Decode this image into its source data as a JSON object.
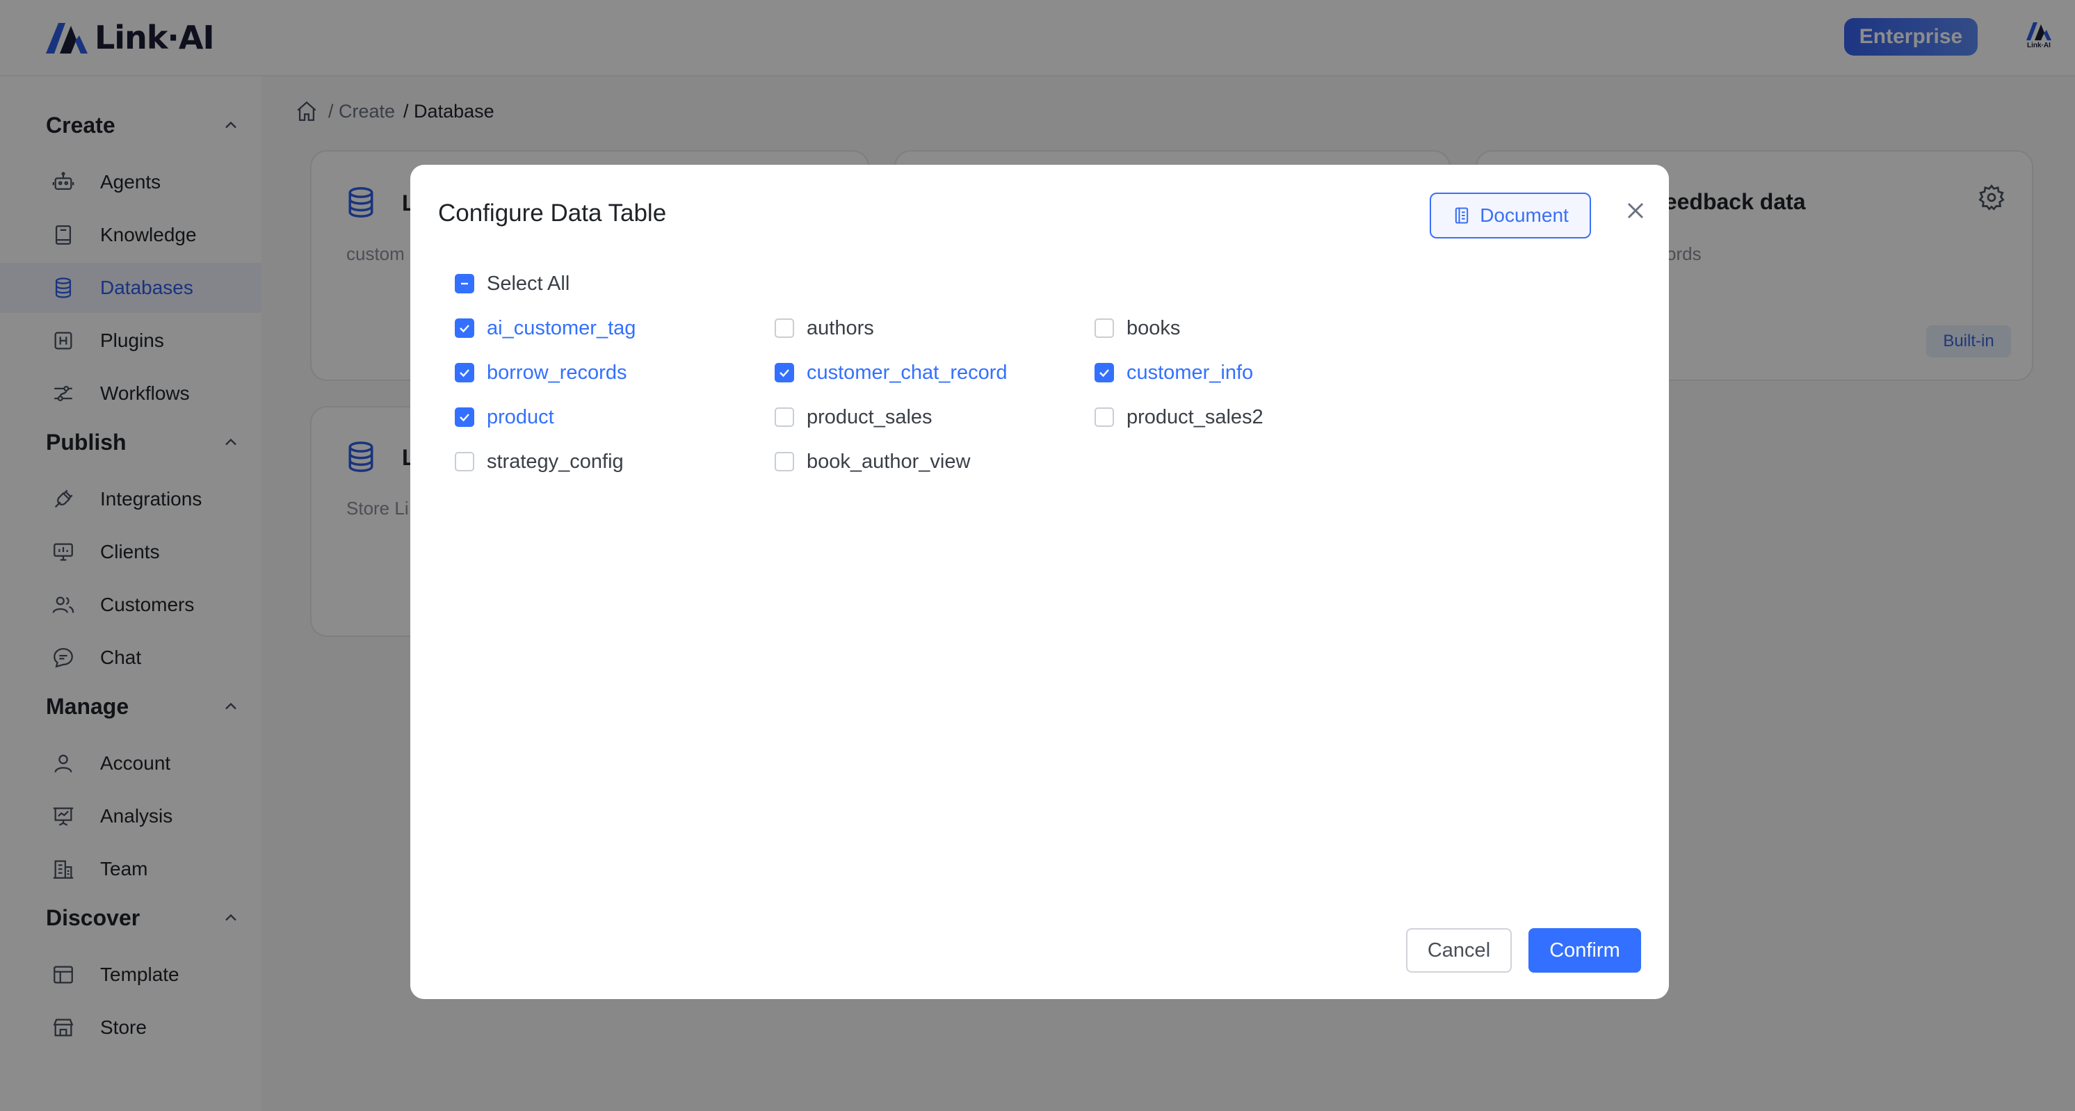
{
  "header": {
    "logo_text": "Link·AI",
    "enterprise_label": "Enterprise",
    "avatar_text": "Link·AI"
  },
  "sidebar": {
    "groups": [
      {
        "title": "Create",
        "items": [
          {
            "label": "Agents",
            "icon": "robot-icon"
          },
          {
            "label": "Knowledge",
            "icon": "book-icon"
          },
          {
            "label": "Databases",
            "icon": "database-icon",
            "active": true
          },
          {
            "label": "Plugins",
            "icon": "plugin-icon"
          },
          {
            "label": "Workflows",
            "icon": "workflow-icon"
          }
        ]
      },
      {
        "title": "Publish",
        "items": [
          {
            "label": "Integrations",
            "icon": "plug-icon"
          },
          {
            "label": "Clients",
            "icon": "monitor-icon"
          },
          {
            "label": "Customers",
            "icon": "users-icon"
          },
          {
            "label": "Chat",
            "icon": "chat-icon"
          }
        ]
      },
      {
        "title": "Manage",
        "items": [
          {
            "label": "Account",
            "icon": "user-icon"
          },
          {
            "label": "Analysis",
            "icon": "presentation-chart-icon"
          },
          {
            "label": "Team",
            "icon": "building-icon"
          }
        ]
      },
      {
        "title": "Discover",
        "items": [
          {
            "label": "Template",
            "icon": "layout-icon"
          },
          {
            "label": "Store",
            "icon": "store-icon"
          }
        ]
      }
    ]
  },
  "breadcrumb": {
    "items": [
      "/ Create",
      "/ Database"
    ]
  },
  "cards": [
    {
      "title": "L",
      "description": "custom"
    },
    {
      "title": "er feedback data",
      "description": "ords",
      "badge": "Built-in"
    },
    {
      "title": "L",
      "description": "Store Li"
    }
  ],
  "modal": {
    "title": "Configure Data Table",
    "document_label": "Document",
    "select_all": {
      "label": "Select All",
      "state": "indeterminate"
    },
    "tables": [
      {
        "label": "ai_customer_tag",
        "checked": true
      },
      {
        "label": "authors",
        "checked": false
      },
      {
        "label": "books",
        "checked": false
      },
      {
        "label": "borrow_records",
        "checked": true
      },
      {
        "label": "customer_chat_record",
        "checked": true
      },
      {
        "label": "customer_info",
        "checked": true
      },
      {
        "label": "product",
        "checked": true
      },
      {
        "label": "product_sales",
        "checked": false
      },
      {
        "label": "product_sales2",
        "checked": false
      },
      {
        "label": "strategy_config",
        "checked": false
      },
      {
        "label": "book_author_view",
        "checked": false
      }
    ],
    "cancel_label": "Cancel",
    "confirm_label": "Confirm"
  },
  "colors": {
    "accent": "#3370ff",
    "active_nav_bg": "#eef3fe",
    "overlay": "rgba(0,0,0,0.45)"
  }
}
